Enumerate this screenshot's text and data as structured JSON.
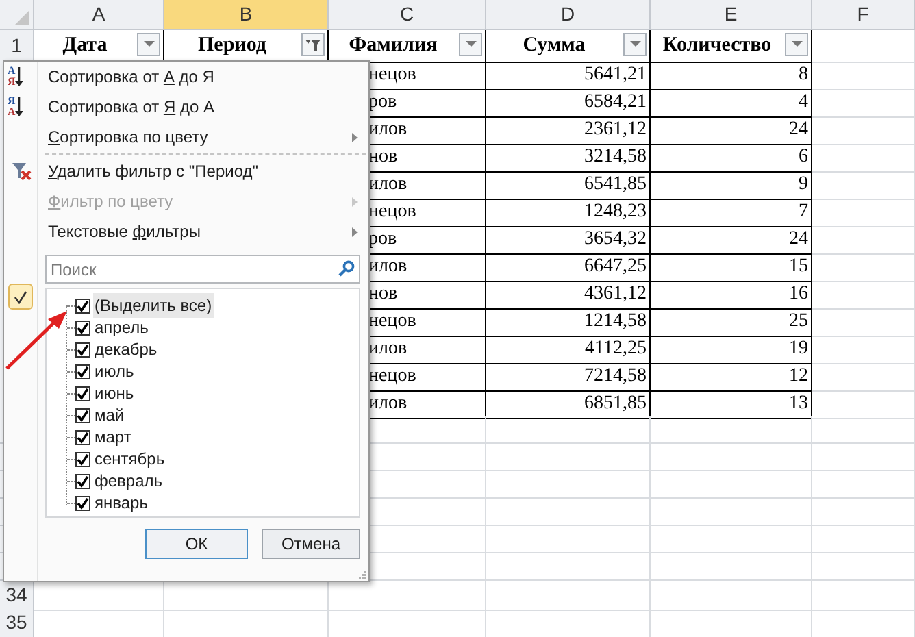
{
  "columns": [
    {
      "letter": "A",
      "selected": false
    },
    {
      "letter": "B",
      "selected": true
    },
    {
      "letter": "C",
      "selected": false
    },
    {
      "letter": "D",
      "selected": false
    },
    {
      "letter": "E",
      "selected": false
    },
    {
      "letter": "F",
      "selected": false
    }
  ],
  "header_row": {
    "number": "1",
    "cells": [
      {
        "text": "Дата",
        "filtered": false
      },
      {
        "text": "Период",
        "filtered": true
      },
      {
        "text": "Фамилия",
        "filtered": false
      },
      {
        "text": "Сумма",
        "filtered": false
      },
      {
        "text": "Количество",
        "filtered": false
      }
    ]
  },
  "rows": [
    {
      "surname": "нецов",
      "sum": "5641,21",
      "quantity": "8"
    },
    {
      "surname": "ров",
      "sum": "6584,21",
      "quantity": "4"
    },
    {
      "surname": "илов",
      "sum": "2361,12",
      "quantity": "24"
    },
    {
      "surname": "нов",
      "sum": "3214,58",
      "quantity": "6"
    },
    {
      "surname": "илов",
      "sum": "6541,85",
      "quantity": "9"
    },
    {
      "surname": "нецов",
      "sum": "1248,23",
      "quantity": "7"
    },
    {
      "surname": "ров",
      "sum": "3654,32",
      "quantity": "24"
    },
    {
      "surname": "илов",
      "sum": "6647,25",
      "quantity": "15"
    },
    {
      "surname": "нов",
      "sum": "4361,12",
      "quantity": "16"
    },
    {
      "surname": "нецов",
      "sum": "1214,58",
      "quantity": "25"
    },
    {
      "surname": "илов",
      "sum": "4112,25",
      "quantity": "19"
    },
    {
      "surname": "нецов",
      "sum": "7214,58",
      "quantity": "12"
    },
    {
      "surname": "илов",
      "sum": "6851,85",
      "quantity": "13"
    }
  ],
  "bottom_rows": [
    "34",
    "35"
  ],
  "filter_menu": {
    "items": [
      {
        "kind": "sort_asc",
        "icon_letters": [
          "А",
          "Я"
        ],
        "before": "Сортировка от ",
        "key": "А",
        "after": " до Я",
        "disabled": false,
        "submenu": false
      },
      {
        "kind": "sort_desc",
        "icon_letters": [
          "Я",
          "А"
        ],
        "before": "Сортировка от ",
        "key": "Я",
        "after": " до А",
        "disabled": false,
        "submenu": false
      },
      {
        "kind": "sort_color",
        "key": "С",
        "after": "ортировка по цвету",
        "disabled": false,
        "submenu": true
      },
      {
        "kind": "separator"
      },
      {
        "kind": "clear_filter",
        "key": "У",
        "after": "далить фильтр с \"Период\"",
        "disabled": false,
        "submenu": false
      },
      {
        "kind": "color_filter",
        "key": "Ф",
        "after": "ильтр по цвету",
        "disabled": true,
        "submenu": true
      },
      {
        "kind": "text_filters",
        "before": "Текстовые ",
        "key": "ф",
        "after": "ильтры",
        "disabled": false,
        "submenu": true
      }
    ],
    "search": {
      "placeholder": "Поиск"
    },
    "values": [
      {
        "label": "(Выделить все)",
        "checked": true,
        "selected": true
      },
      {
        "label": "апрель",
        "checked": true,
        "selected": false
      },
      {
        "label": "декабрь",
        "checked": true,
        "selected": false
      },
      {
        "label": "июль",
        "checked": true,
        "selected": false
      },
      {
        "label": "июнь",
        "checked": true,
        "selected": false
      },
      {
        "label": "май",
        "checked": true,
        "selected": false
      },
      {
        "label": "март",
        "checked": true,
        "selected": false
      },
      {
        "label": "сентябрь",
        "checked": true,
        "selected": false
      },
      {
        "label": "февраль",
        "checked": true,
        "selected": false
      },
      {
        "label": "январь",
        "checked": true,
        "selected": false
      }
    ],
    "buttons": [
      {
        "label": "ОК",
        "default": true
      },
      {
        "label": "Отмена",
        "default": false
      }
    ]
  }
}
